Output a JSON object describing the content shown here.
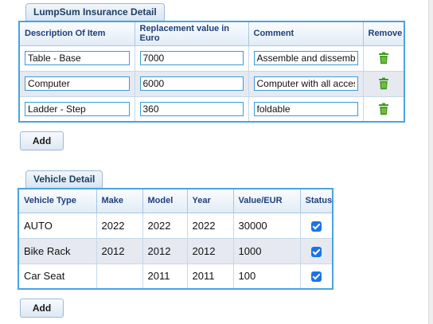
{
  "lumpsum": {
    "tab_label": "LumpSum Insurance Detail",
    "headers": {
      "description": "Description Of Item",
      "replacement": "Replacement value in Euro",
      "comment": "Comment",
      "remove": "Remove"
    },
    "rows": [
      {
        "description": "Table - Base",
        "replacement": "7000",
        "comment": "Assemble and dissemble",
        "remove_icon": "trash-icon"
      },
      {
        "description": "Computer",
        "replacement": "6000",
        "comment": "Computer with all accessories",
        "remove_icon": "trash-icon"
      },
      {
        "description": "Ladder - Step",
        "replacement": "360",
        "comment": "foldable",
        "remove_icon": "trash-icon"
      }
    ],
    "add_label": "Add"
  },
  "vehicle": {
    "tab_label": "Vehicle Detail",
    "headers": {
      "type": "Vehicle Type",
      "make": "Make",
      "model": "Model",
      "year": "Year",
      "value": "Value/EUR",
      "status": "Status"
    },
    "rows": [
      {
        "type": "AUTO",
        "make": "2022",
        "model": "2022",
        "year": "2022",
        "value": "30000",
        "status_checked": true
      },
      {
        "type": "Bike Rack",
        "make": "2012",
        "model": "2012",
        "year": "2012",
        "value": "1000",
        "status_checked": true
      },
      {
        "type": "Car Seat",
        "make": "",
        "model": "2011",
        "year": "2011",
        "value": "100",
        "status_checked": true
      }
    ],
    "add_label": "Add"
  },
  "colors": {
    "table_border": "#4aa3df",
    "header_text": "#1f3f7a",
    "alt_row": "#e7e9f1",
    "trash_green": "#3f9a16",
    "checkbox_blue": "#1a73e8"
  }
}
